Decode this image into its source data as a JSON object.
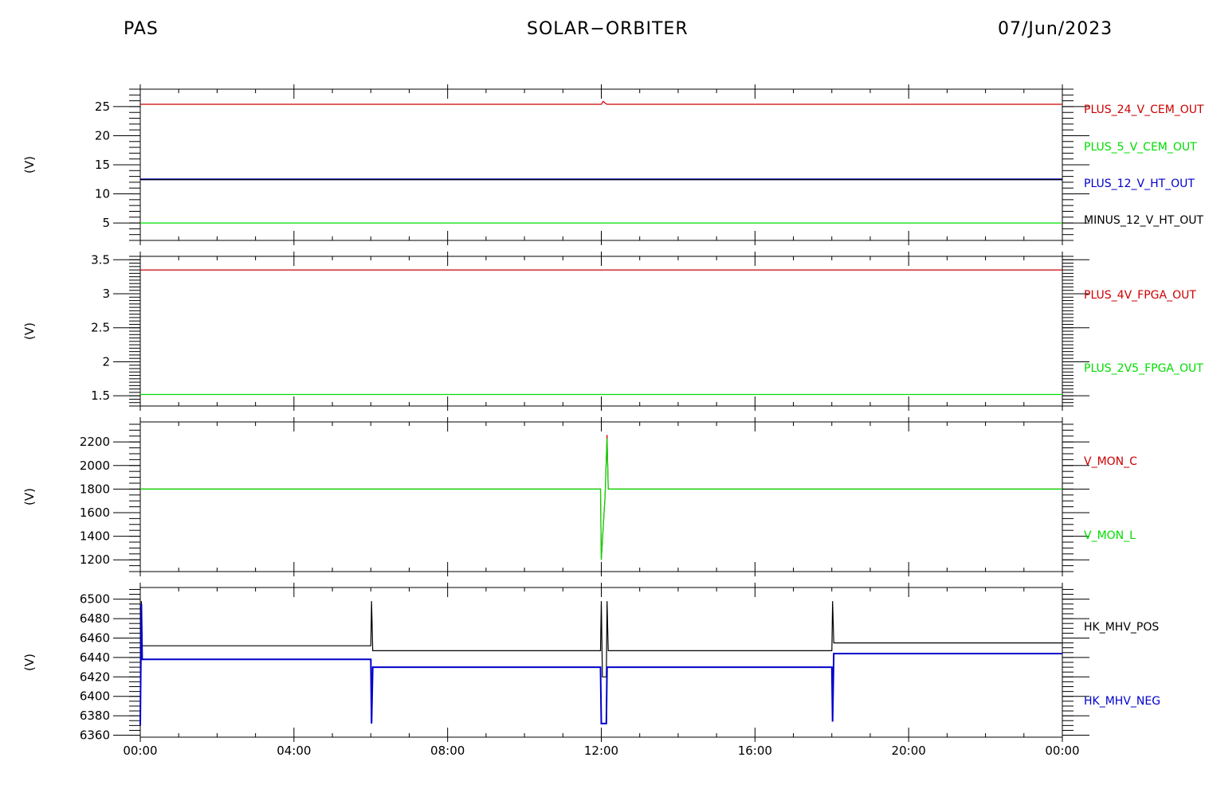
{
  "header": {
    "left": "PAS",
    "center": "SOLAR−ORBITER",
    "right": "07/Jun/2023"
  },
  "colors": {
    "red": "#cc0000",
    "green": "#00dd00",
    "blue": "#0000cc",
    "black": "#000000"
  },
  "chart_data": [
    {
      "type": "line",
      "ylabel": "(V)",
      "ylim": [
        2,
        28
      ],
      "yticks": [
        5,
        10,
        15,
        20,
        25
      ],
      "series": [
        {
          "name": "PLUS_24_V_CEM_OUT",
          "color": "#cc0000",
          "points": [
            [
              0,
              25.4
            ],
            [
              12.0,
              25.4
            ],
            [
              12.05,
              25.9
            ],
            [
              12.1,
              25.6
            ],
            [
              12.15,
              25.4
            ],
            [
              24,
              25.4
            ]
          ]
        },
        {
          "name": "PLUS_5_V_CEM_OUT",
          "color": "#00dd00",
          "points": [
            [
              0,
              5.0
            ],
            [
              24,
              5.0
            ]
          ]
        },
        {
          "name": "PLUS_12_V_HT_OUT",
          "color": "#0000cc",
          "points": [
            [
              0,
              12.5
            ],
            [
              24,
              12.5
            ]
          ]
        },
        {
          "name": "MINUS_12_V_HT_OUT",
          "color": "#000000",
          "points": [
            [
              0,
              12.45
            ],
            [
              24,
              12.45
            ]
          ]
        }
      ]
    },
    {
      "type": "line",
      "ylabel": "(V)",
      "ylim": [
        1.35,
        3.55
      ],
      "yticks": [
        1.5,
        2.0,
        2.5,
        3.0,
        3.5
      ],
      "series": [
        {
          "name": "PLUS_4V_FPGA_OUT",
          "color": "#cc0000",
          "points": [
            [
              0,
              3.35
            ],
            [
              24,
              3.35
            ]
          ]
        },
        {
          "name": "PLUS_2V5_FPGA_OUT",
          "color": "#00dd00",
          "points": [
            [
              0,
              1.52
            ],
            [
              24,
              1.52
            ]
          ]
        }
      ]
    },
    {
      "type": "line",
      "ylabel": "(V)",
      "ylim": [
        1100,
        2370
      ],
      "yticks": [
        1200,
        1400,
        1600,
        1800,
        2000,
        2200
      ],
      "series": [
        {
          "name": "V_MON_C",
          "color": "#cc0000",
          "points": [
            [
              0,
              1800
            ],
            [
              11.98,
              1800
            ],
            [
              12.0,
              1200
            ],
            [
              12.1,
              1750
            ],
            [
              12.15,
              2260
            ],
            [
              12.18,
              1800
            ],
            [
              24,
              1800
            ]
          ]
        },
        {
          "name": "V_MON_L",
          "color": "#00dd00",
          "points": [
            [
              0,
              1800
            ],
            [
              11.98,
              1800
            ],
            [
              12.0,
              1200
            ],
            [
              12.1,
              1750
            ],
            [
              12.15,
              2230
            ],
            [
              12.18,
              1800
            ],
            [
              24,
              1800
            ]
          ]
        }
      ]
    },
    {
      "type": "line",
      "ylabel": "(V)",
      "ylim": [
        6358,
        6512
      ],
      "yticks": [
        6360,
        6380,
        6400,
        6420,
        6440,
        6460,
        6480,
        6500
      ],
      "series": [
        {
          "name": "HK_MHV_POS",
          "color": "#000000",
          "points": [
            [
              0,
              6370
            ],
            [
              0.03,
              6498
            ],
            [
              0.05,
              6452
            ],
            [
              6.0,
              6452
            ],
            [
              6.02,
              6498
            ],
            [
              6.05,
              6447
            ],
            [
              11.98,
              6447
            ],
            [
              12.0,
              6498
            ],
            [
              12.03,
              6420
            ],
            [
              12.13,
              6420
            ],
            [
              12.15,
              6498
            ],
            [
              12.18,
              6447
            ],
            [
              18.0,
              6447
            ],
            [
              18.02,
              6498
            ],
            [
              18.05,
              6455
            ],
            [
              24,
              6455
            ]
          ]
        },
        {
          "name": "HK_MHV_NEG",
          "color": "#0000cc",
          "points": [
            [
              0,
              6370
            ],
            [
              0.03,
              6495
            ],
            [
              0.05,
              6438
            ],
            [
              6.0,
              6438
            ],
            [
              6.02,
              6372
            ],
            [
              6.05,
              6430
            ],
            [
              11.98,
              6430
            ],
            [
              12.0,
              6372
            ],
            [
              12.13,
              6372
            ],
            [
              12.15,
              6430
            ],
            [
              18.0,
              6430
            ],
            [
              18.02,
              6374
            ],
            [
              18.05,
              6444
            ],
            [
              24,
              6444
            ]
          ]
        }
      ]
    }
  ],
  "xaxis": {
    "range": [
      0,
      24
    ],
    "ticks": [
      0,
      4,
      8,
      12,
      16,
      20,
      24
    ],
    "labels": [
      "00:00",
      "04:00",
      "08:00",
      "12:00",
      "16:00",
      "20:00",
      "00:00"
    ]
  }
}
